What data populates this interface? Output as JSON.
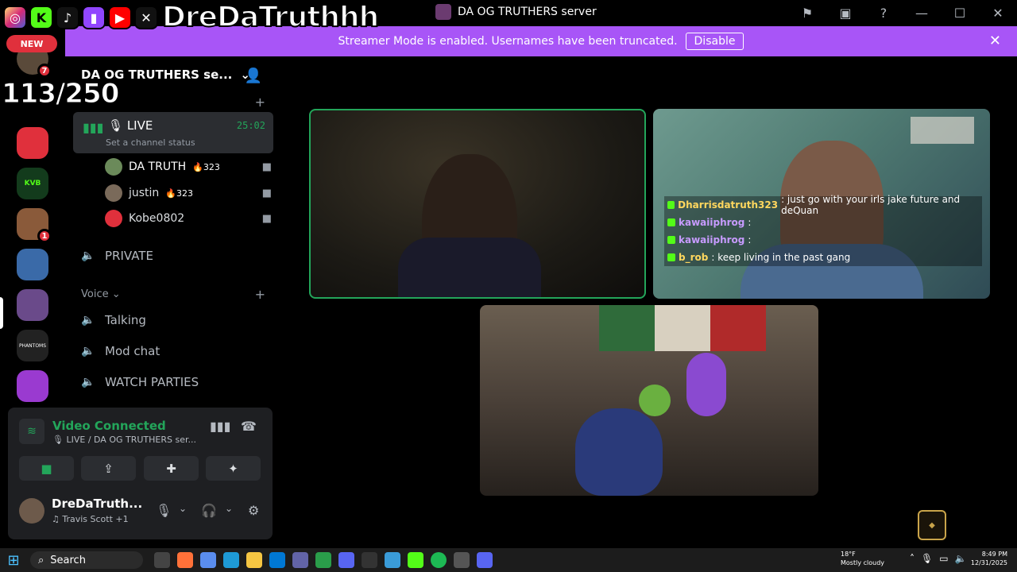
{
  "overlay": {
    "social_icons": [
      "instagram-icon",
      "kick-icon",
      "tiktok-icon",
      "twitch-icon",
      "youtube-icon",
      "x-icon"
    ],
    "streamer_name": "DreDaTruthhh",
    "new_badge": "NEW",
    "counter": "113/250"
  },
  "window": {
    "title": "DA OG TRUTHERS server"
  },
  "banner": {
    "text": "Streamer Mode is enabled. Usernames have been truncated.",
    "disable_label": "Disable",
    "close": "✕",
    "color": "#a855f7"
  },
  "server_list": {
    "pings": [
      "7",
      "1"
    ]
  },
  "sidebar": {
    "server_name": "DA OG TRUTHERS se...",
    "live_channel": {
      "name": "LIVE",
      "timer": "25:02",
      "status": "Set a channel status"
    },
    "members": [
      {
        "name": "DA TRUTH",
        "streak": "323"
      },
      {
        "name": "justin",
        "streak": "323"
      },
      {
        "name": "Kobe0802",
        "streak": ""
      }
    ],
    "private_channel": "PRIVATE",
    "voice_category": "Voice",
    "voice_channels": [
      "Talking",
      "Mod chat",
      "WATCH PARTIES"
    ]
  },
  "voice_panel": {
    "title": "Video Connected",
    "subtitle": "LIVE / DA OG TRUTHERS ser...",
    "accent": "#23a55a"
  },
  "user": {
    "name": "DreDaTruth...",
    "status": "Travis Scott +1"
  },
  "chat_overlay": [
    {
      "user": "Dharrisdatruth323",
      "message": ": just go with your irls jake future and deQuan"
    },
    {
      "user": "kawaiiphrog",
      "message": ":"
    },
    {
      "user": "kawaiiphrog",
      "message": ":"
    },
    {
      "user": "b_rob",
      "message": ": keep living in the past gang"
    }
  ],
  "taskbar": {
    "search": "Search",
    "weather_temp": "18°F",
    "weather_desc": "Mostly cloudy",
    "time": "8:49 PM",
    "date": "12/31/2025"
  }
}
